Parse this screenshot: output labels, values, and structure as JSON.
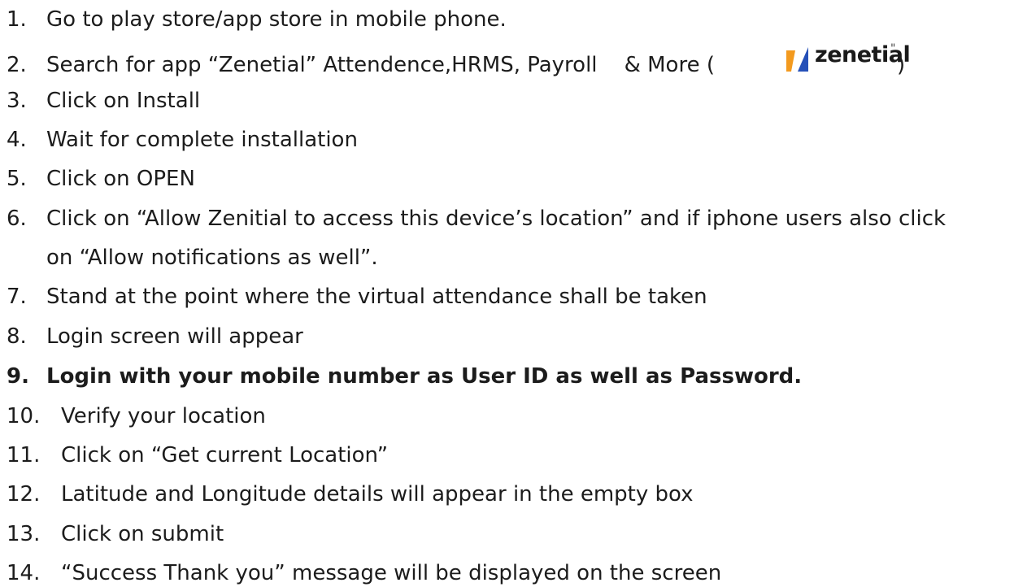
{
  "steps": [
    {
      "num": "1.",
      "text": "Go to play store/app store in mobile phone."
    },
    {
      "num": "2.",
      "text": "Search for app “Zenetial” Attendence,HRMS, Payroll    & More ("
    },
    {
      "num": "3.",
      "text": "Click on Install"
    },
    {
      "num": "4.",
      "text": "Wait for complete installation"
    },
    {
      "num": "5.",
      "text": "Click on OPEN"
    },
    {
      "num": "6.",
      "text": "Click on “Allow Zenitial to access this device’s location” and if iphone users also click",
      "continuation": "on “Allow notifications as well”."
    },
    {
      "num": "7.",
      "text": "Stand at the point where the virtual attendance shall be taken"
    },
    {
      "num": "8.",
      "text": "Login screen will appear"
    },
    {
      "num": "9.",
      "text": "Login with your mobile number as User ID as well as Password."
    },
    {
      "num": "10.",
      "text": "Verify your location"
    },
    {
      "num": "11.",
      "text": "Click on “Get current Location”"
    },
    {
      "num": "12.",
      "text": "Latitude and Longitude details will appear in the empty box"
    },
    {
      "num": "13.",
      "text": "Click on submit"
    },
    {
      "num": "14.",
      "text": "“Success Thank you” message will be displayed on the screen"
    }
  ],
  "logo": {
    "text": "zenetial",
    "mark": "\"",
    "close_paren": ")",
    "colors": {
      "orange": "#f39a1e",
      "blue": "#2550b8",
      "text": "#1a1a1a"
    }
  }
}
